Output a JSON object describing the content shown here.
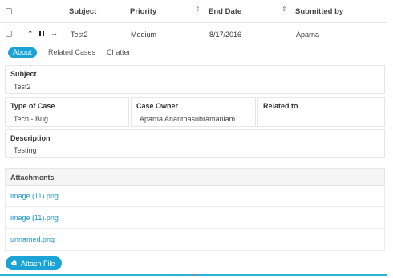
{
  "header": {
    "subject": "Subject",
    "priority": "Priority",
    "end_date": "End Date",
    "submitted_by": "Submitted by",
    "sort_icon": "⇕"
  },
  "row": {
    "subject": "Test2",
    "priority": "Medium",
    "end_date": "8/17/2016",
    "submitted_by": "Aparna",
    "icons": {
      "expand": "⌃",
      "next": "→"
    }
  },
  "tabs": [
    {
      "label": "About",
      "active": true
    },
    {
      "label": "Related Cases",
      "active": false
    },
    {
      "label": "Chatter",
      "active": false
    }
  ],
  "fields": {
    "subject": {
      "label": "Subject",
      "value": "Test2"
    },
    "type_of_case": {
      "label": "Type of Case",
      "value": "Tech - Bug"
    },
    "case_owner": {
      "label": "Case Owner",
      "value": "Aparna Ananthasubramaniam"
    },
    "related_to": {
      "label": "Related to",
      "value": ""
    },
    "description": {
      "label": "Description",
      "value": "Testing"
    }
  },
  "attachments": {
    "title": "Attachments",
    "items": [
      "image (11).png",
      "image (11).png",
      "unnamed.png"
    ]
  },
  "attach_button": {
    "label": "Attach File",
    "icon": "cloud-upload-icon"
  },
  "colors": {
    "accent": "#1ba3d6",
    "link": "#1a96c8",
    "bottom_bar": "#27b3d6"
  },
  "grip": "▪▪▪"
}
